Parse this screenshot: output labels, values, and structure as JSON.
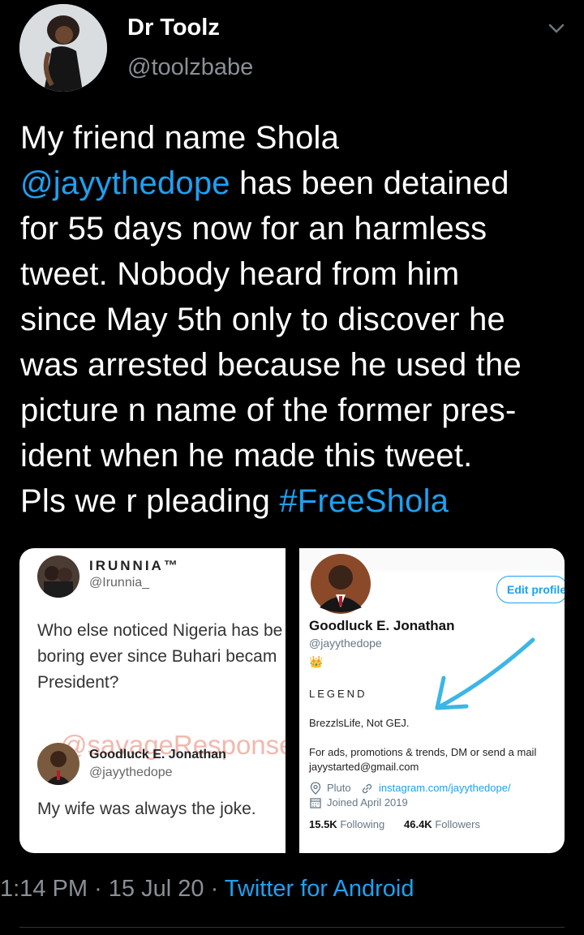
{
  "author": {
    "name": "Dr Toolz",
    "handle": "@toolzbabe"
  },
  "tweet": {
    "lines": [
      "My friend name Shola",
      "has been detained",
      "for 55 days now for an harmless",
      "tweet. Nobody heard from him",
      "since May 5th only to discover he",
      "was arrested because he used the",
      "picture n name of the former pres-",
      "ident when he made this tweet.",
      "Pls we r pleading"
    ],
    "mention": "@jayythedope",
    "hashtag": "#FreeShola"
  },
  "left_card": {
    "top_user": {
      "name": "IRUNNIA™",
      "handle": "@Irunnia_"
    },
    "top_text": [
      "Who else noticed Nigeria has be",
      "boring ever since Buhari becam",
      "President?"
    ],
    "watermark": "@savageResponse",
    "reply_user": {
      "name": "Goodluck E. Jonathan",
      "handle": "@jayythedope"
    },
    "reply_text": "My wife was always the joke."
  },
  "right_card": {
    "edit_button": "Edit profile",
    "name": "Goodluck E. Jonathan",
    "handle": "@jayythedope",
    "emoji": "👑",
    "bio_title": "LEGEND",
    "bio_line": "BrezzlsLife, Not GEJ.",
    "bio_contact": [
      "For ads, promotions & trends, DM or send a mail",
      "jayystarted@gmail.com"
    ],
    "location": "Pluto",
    "website": "instagram.com/jayythedope/",
    "joined": "Joined April 2019",
    "following_count": "15.5K",
    "following_label": "Following",
    "followers_count": "46.4K",
    "followers_label": "Followers"
  },
  "meta": {
    "time": "1:14 PM",
    "sep": "·",
    "date": "15 Jul 20",
    "source": "Twitter for Android"
  },
  "colors": {
    "link": "#1da1f2",
    "background": "#000000",
    "muted": "#8a9096"
  }
}
